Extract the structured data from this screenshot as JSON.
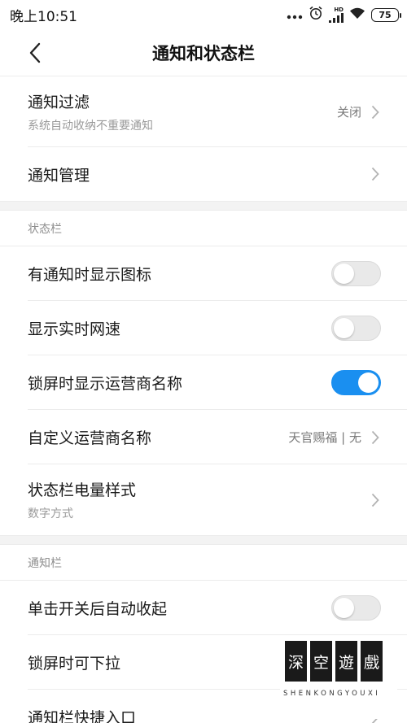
{
  "status_bar": {
    "time": "晚上10:51",
    "network_badge": "HD",
    "battery": "75"
  },
  "header": {
    "title": "通知和状态栏"
  },
  "top_section": {
    "notification_filter": {
      "title": "通知过滤",
      "subtitle": "系统自动收纳不重要通知",
      "value": "关闭"
    },
    "notification_management": {
      "title": "通知管理"
    }
  },
  "status_bar_section": {
    "label": "状态栏",
    "show_icon_on_notify": {
      "title": "有通知时显示图标",
      "enabled": false
    },
    "show_net_speed": {
      "title": "显示实时网速",
      "enabled": false
    },
    "show_carrier_on_lock": {
      "title": "锁屏时显示运营商名称",
      "enabled": true
    },
    "custom_carrier": {
      "title": "自定义运营商名称",
      "value": "天官赐福 | 无"
    },
    "battery_style": {
      "title": "状态栏电量样式",
      "subtitle": "数字方式"
    }
  },
  "notification_bar_section": {
    "label": "通知栏",
    "auto_collapse": {
      "title": "单击开关后自动收起",
      "enabled": false
    },
    "pull_down_on_lock": {
      "title": "锁屏时可下拉"
    },
    "quick_entry": {
      "title": "通知栏快捷入口"
    }
  },
  "watermark": {
    "chars": [
      "深",
      "空",
      "遊",
      "戲"
    ],
    "text": "SHENKONGYOUXI"
  },
  "colors": {
    "accent": "#1a8ff0",
    "toggle_off": "#e9e9e9",
    "divider": "#ececec"
  }
}
